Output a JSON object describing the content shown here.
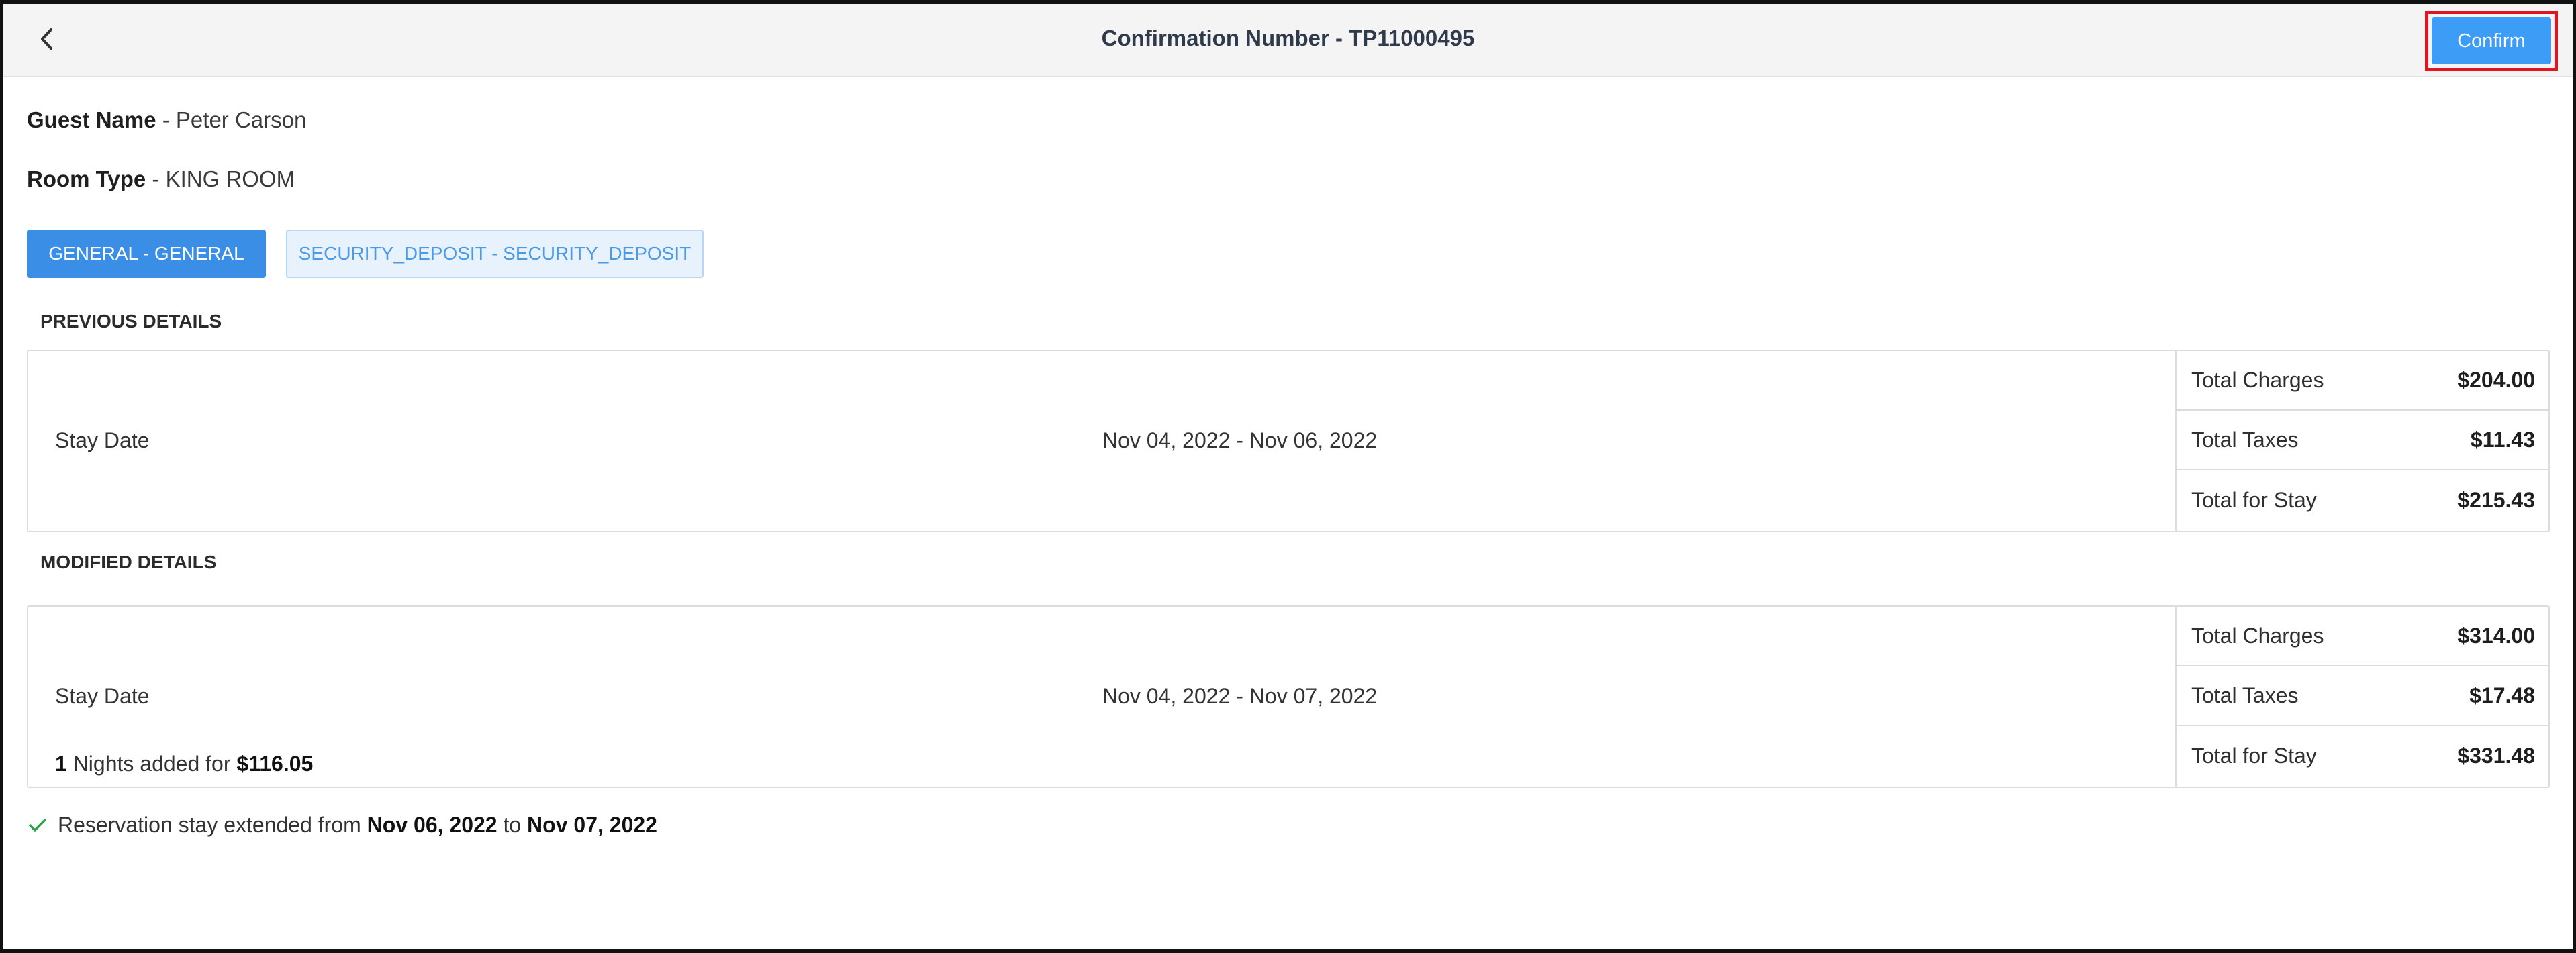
{
  "header": {
    "title": "Confirmation Number - TP11000495",
    "confirm_label": "Confirm"
  },
  "guest": {
    "label": "Guest Name",
    "value": "- Peter Carson"
  },
  "room": {
    "label": "Room Type",
    "value": "- KING ROOM"
  },
  "tabs": [
    {
      "label": "GENERAL - GENERAL",
      "active": true
    },
    {
      "label": "SECURITY_DEPOSIT - SECURITY_DEPOSIT",
      "active": false
    }
  ],
  "previous": {
    "title": "PREVIOUS DETAILS",
    "stay_label": "Stay Date",
    "stay_value": "Nov 04, 2022 - Nov 06, 2022",
    "totals": [
      {
        "label": "Total Charges",
        "amount": "$204.00"
      },
      {
        "label": "Total Taxes",
        "amount": "$11.43"
      },
      {
        "label": "Total for Stay",
        "amount": "$215.43"
      }
    ]
  },
  "modified": {
    "title": "MODIFIED DETAILS",
    "stay_label": "Stay Date",
    "stay_value": "Nov 04, 2022 - Nov 07, 2022",
    "nights_count": "1",
    "nights_text": "Nights added for",
    "nights_amount": "$116.05",
    "totals": [
      {
        "label": "Total Charges",
        "amount": "$314.00"
      },
      {
        "label": "Total Taxes",
        "amount": "$17.48"
      },
      {
        "label": "Total for Stay",
        "amount": "$331.48"
      }
    ]
  },
  "extension": {
    "text_prefix": "Reservation stay extended from",
    "from_date": "Nov 06, 2022",
    "to_word": "to",
    "to_date": "Nov 07, 2022"
  },
  "colors": {
    "primary": "#3d9df6",
    "highlight_border": "#e0161f",
    "success": "#2e9e4a"
  },
  "icons": {
    "back": "chevron-left-icon",
    "check": "check-icon"
  }
}
